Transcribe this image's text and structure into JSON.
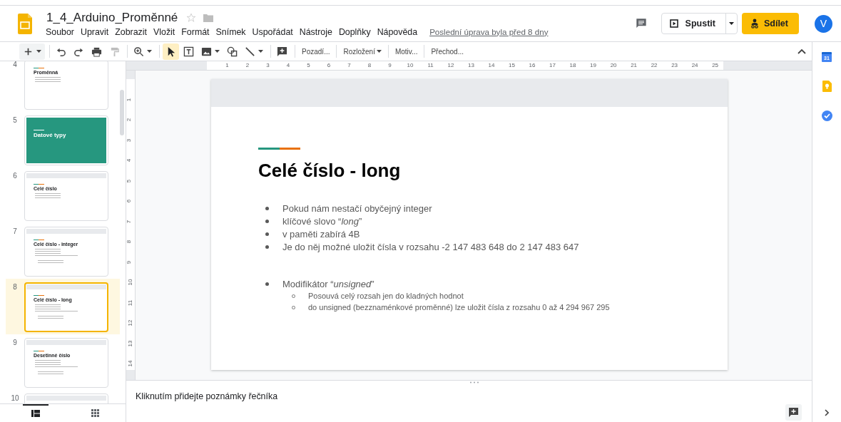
{
  "document": {
    "title": "1_4_Arduino_Proměnné",
    "starred": false
  },
  "menu": [
    "Soubor",
    "Upravit",
    "Zobrazit",
    "Vložit",
    "Formát",
    "Snímek",
    "Uspořádat",
    "Nástroje",
    "Doplňky",
    "Nápověda"
  ],
  "last_edit": "Poslední úprava byla před 8 dny",
  "present_button": "Spustit",
  "share_button": "Sdílet",
  "avatar": "V",
  "tools": [
    {
      "kind": "new",
      "selected": false,
      "disabled": false,
      "has_menu": true
    },
    {
      "kind": "undo",
      "selected": false,
      "disabled": false,
      "has_menu": false
    },
    {
      "kind": "redo",
      "selected": false,
      "disabled": false,
      "has_menu": false
    },
    {
      "kind": "print",
      "selected": false,
      "disabled": false,
      "has_menu": false
    },
    {
      "kind": "paint",
      "selected": false,
      "disabled": true,
      "has_menu": false
    },
    {
      "kind": "zoom",
      "selected": false,
      "disabled": false,
      "has_menu": true
    },
    {
      "kind": "pointer",
      "selected": true,
      "disabled": false,
      "has_menu": false
    },
    {
      "kind": "textbox",
      "selected": false,
      "disabled": false,
      "has_menu": false
    },
    {
      "kind": "image",
      "selected": false,
      "disabled": false,
      "has_menu": true
    },
    {
      "kind": "shape",
      "selected": false,
      "disabled": false,
      "has_menu": false
    },
    {
      "kind": "line",
      "selected": false,
      "disabled": false,
      "has_menu": true
    },
    {
      "kind": "comment",
      "selected": false,
      "disabled": false,
      "has_menu": false
    }
  ],
  "toolbar_buttons": [
    {
      "label": "Pozadí...",
      "has_menu": false
    },
    {
      "label": "Rozložení",
      "has_menu": true
    },
    {
      "label": "Motiv...",
      "has_menu": false
    },
    {
      "label": "Přechod...",
      "has_menu": false
    }
  ],
  "ruler_h": [
    "1",
    "2",
    "3",
    "4",
    "5",
    "6",
    "7",
    "8",
    "9",
    "10",
    "11",
    "12",
    "13",
    "14",
    "15",
    "16",
    "17",
    "18",
    "19",
    "20",
    "21",
    "22",
    "23",
    "24",
    "25"
  ],
  "ruler_v": [
    "1",
    "2",
    "3",
    "4",
    "5",
    "6",
    "7",
    "8",
    "9",
    "10",
    "11",
    "12",
    "13",
    "14"
  ],
  "slides": [
    {
      "number": "4",
      "title": "Proměnná",
      "kind": "content",
      "selected": false
    },
    {
      "number": "5",
      "title": "Datové typy",
      "kind": "section",
      "selected": false
    },
    {
      "number": "6",
      "title": "Celé číslo",
      "kind": "content",
      "selected": false
    },
    {
      "number": "7",
      "title": "Celé číslo - integer",
      "kind": "content",
      "selected": false
    },
    {
      "number": "8",
      "title": "Celé číslo - long",
      "kind": "content",
      "selected": true
    },
    {
      "number": "9",
      "title": "Desetinné číslo",
      "kind": "content",
      "selected": false
    },
    {
      "number": "10",
      "kind": "content",
      "selected": false
    }
  ],
  "view_tabs": [
    {
      "kind": "list",
      "selected": true
    },
    {
      "kind": "grid",
      "selected": false
    }
  ],
  "slide": {
    "title": "Celé číslo - long",
    "bullets": [
      {
        "text": "Pokud nám nestačí obyčejný integer"
      },
      {
        "text": "klíčové slovo “*long*”"
      },
      {
        "text": "v paměti zabírá 4B"
      },
      {
        "text": "Je do něj možné uložit čísla v rozsahu -2 147 483 648 do 2 147 483 647"
      },
      {
        "text": "Modifikátor “*unsigned*”",
        "children": [
          {
            "text": "Posouvá celý rozsah jen do kladných hodnot"
          },
          {
            "text": "do unsigned (bezznaménkové proměnné) lze uložit čísla z rozsahu 0 až 4 294 967 295"
          }
        ]
      }
    ]
  },
  "notes": {
    "placeholder": "Kliknutím přidejte poznámky řečníka"
  },
  "side_panel": [
    {
      "kind": "calendar",
      "label": "31"
    },
    {
      "kind": "keep"
    },
    {
      "kind": "tasks"
    }
  ]
}
